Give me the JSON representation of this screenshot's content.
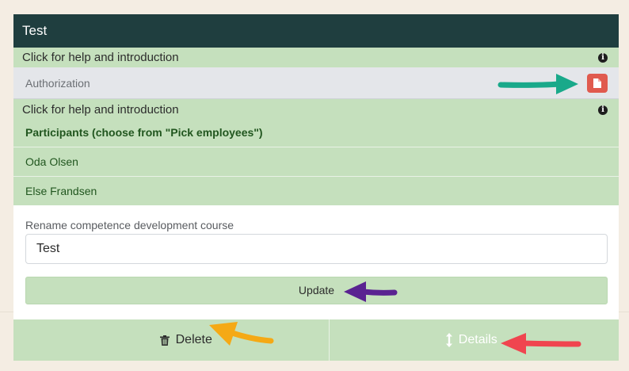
{
  "card": {
    "title": "Test"
  },
  "help": {
    "label_top": "Click for help and introduction",
    "label_second": "Click for help and introduction",
    "info_glyph": "i"
  },
  "authorization": {
    "label": "Authorization",
    "button_icon": "document-icon",
    "button_color": "#e05a4e"
  },
  "participants": {
    "title": "Participants (choose from \"Pick employees\")",
    "items": [
      "Oda Olsen",
      "Else Frandsen"
    ]
  },
  "rename": {
    "label": "Rename competence development course",
    "value": "Test"
  },
  "update_button": {
    "label": "Update"
  },
  "footer": {
    "delete_label": "Delete",
    "delete_icon": "trash-icon",
    "details_label": "Details",
    "details_icon": "vertical-arrows-icon"
  },
  "annotation_arrows": [
    {
      "color": "#19a98a",
      "points_to": "authorization document button"
    },
    {
      "color": "#5a2391",
      "points_to": "update button"
    },
    {
      "color": "#f5a915",
      "points_to": "delete button"
    },
    {
      "color": "#f0454f",
      "points_to": "details button"
    }
  ],
  "colors": {
    "header_bg": "#1f3e3f",
    "green_bg": "#c5e0bd",
    "green_text": "#21561f",
    "auth_bg": "#e4e6ea",
    "page_bg": "#f4ede3"
  }
}
